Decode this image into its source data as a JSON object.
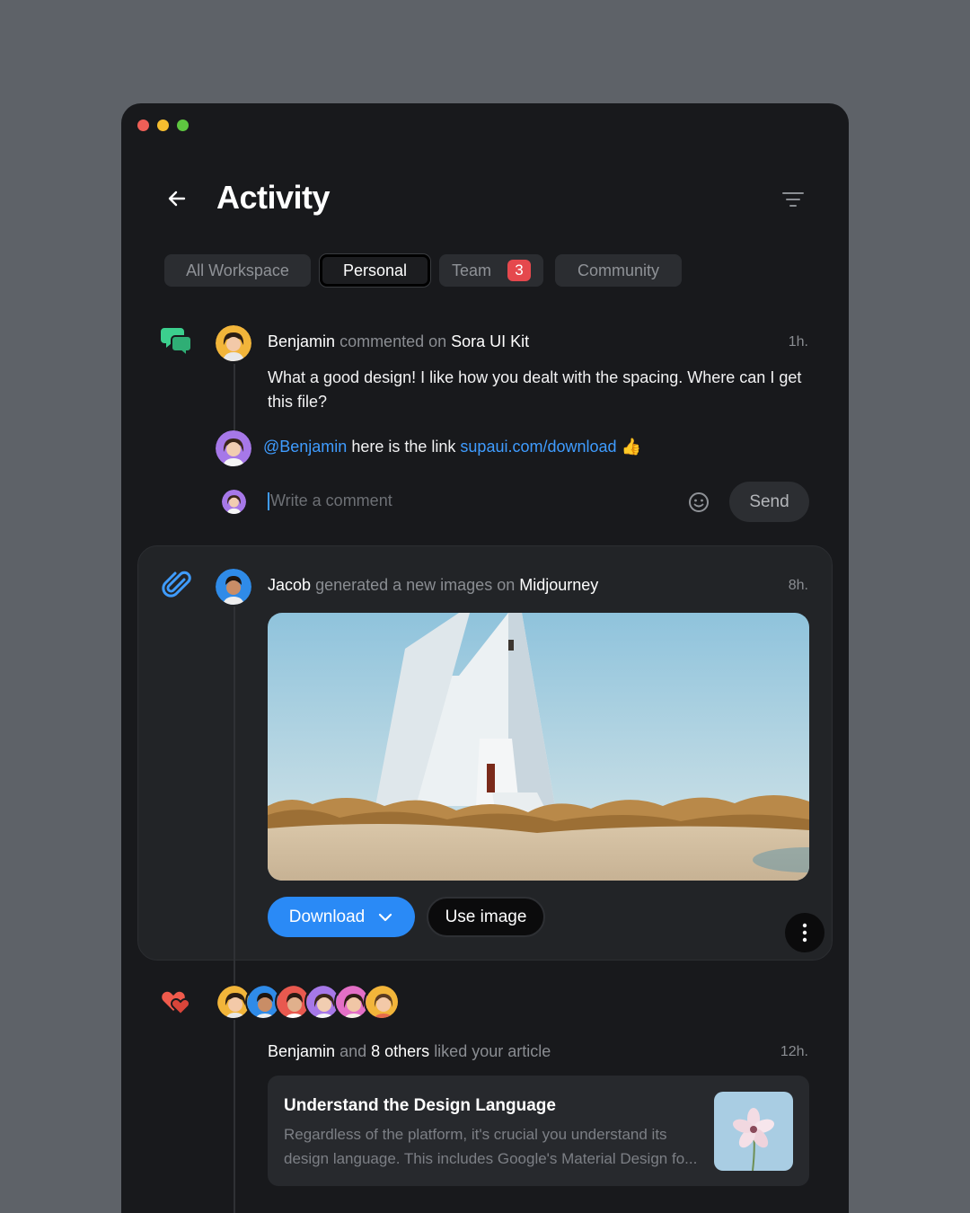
{
  "window": {
    "traffic_colors": [
      "#ee5f57",
      "#f5bd2f",
      "#5ec640"
    ]
  },
  "header": {
    "title": "Activity",
    "back_icon": "arrow-left-icon",
    "filter_icon": "filter-lines-icon"
  },
  "tabs": [
    {
      "label": "All Workspace",
      "active": false
    },
    {
      "label": "Personal",
      "active": true
    },
    {
      "label": "Team",
      "active": false,
      "badge": "3"
    },
    {
      "label": "Community",
      "active": false
    }
  ],
  "feed": {
    "comment_item": {
      "icon": "chat-bubbles-icon",
      "icon_color": "#3ccf8e",
      "user": "Benjamin",
      "action": "commented on",
      "target": "Sora UI Kit",
      "time": "1h.",
      "text": "What a good design! I like how you dealt with the spacing. Where can I get this file?",
      "reply": {
        "mention": "@Benjamin",
        "text": "here is the link",
        "link": "supaui.com/download",
        "emoji": "👍"
      },
      "input_placeholder": "Write a comment",
      "emoji_icon": "smiley-icon",
      "send_label": "Send"
    },
    "image_item": {
      "icon": "paperclip-icon",
      "icon_color": "#3f9cff",
      "user": "Jacob",
      "action": "generated a new images on",
      "target": "Midjourney",
      "time": "8h.",
      "download_label": "Download",
      "use_label": "Use image",
      "more_icon": "more-vertical-icon"
    },
    "like_item": {
      "icon": "hearts-icon",
      "icon_color": "#ef5a4c",
      "user": "Benjamin",
      "joiner": "and",
      "others": "8 others",
      "action": "liked your article",
      "time": "12h.",
      "article": {
        "title": "Understand the Design Language",
        "description": "Regardless of the platform, it's crucial you understand its design language. This includes Google's Material Design fo..."
      }
    }
  }
}
